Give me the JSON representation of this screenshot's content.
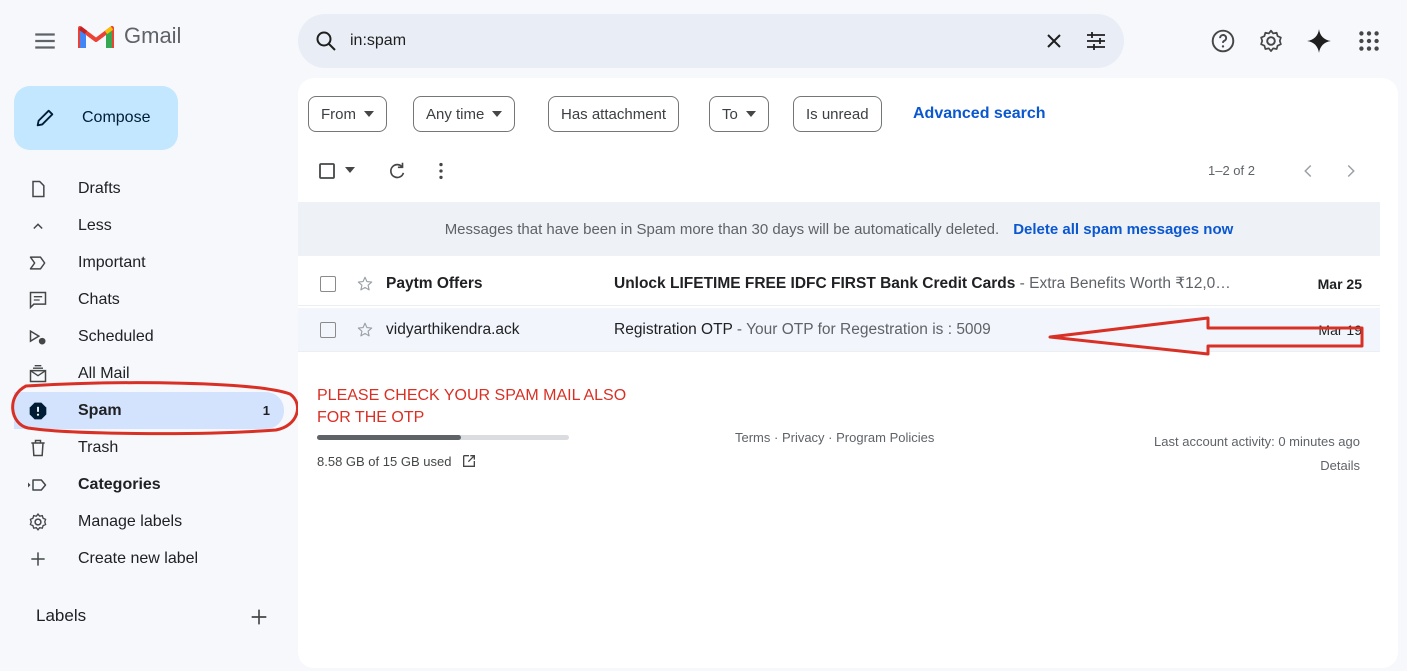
{
  "app": {
    "name": "Gmail"
  },
  "search": {
    "value": "in:spam"
  },
  "sidebar": {
    "compose_label": "Compose",
    "items": [
      {
        "label": "Drafts",
        "icon": "draft-icon"
      },
      {
        "label": "Less",
        "icon": "chevron-up-icon"
      },
      {
        "label": "Important",
        "icon": "important-icon"
      },
      {
        "label": "Chats",
        "icon": "chat-icon"
      },
      {
        "label": "Scheduled",
        "icon": "scheduled-icon"
      },
      {
        "label": "All Mail",
        "icon": "all-mail-icon"
      },
      {
        "label": "Spam",
        "icon": "spam-icon",
        "count": "1",
        "active": true
      },
      {
        "label": "Trash",
        "icon": "trash-icon"
      },
      {
        "label": "Categories",
        "icon": "label-icon"
      },
      {
        "label": "Manage labels",
        "icon": "gear-icon"
      },
      {
        "label": "Create new label",
        "icon": "plus-icon"
      }
    ],
    "labels_heading": "Labels"
  },
  "filters": {
    "from": "From",
    "any_time": "Any time",
    "has_attachment": "Has attachment",
    "to": "To",
    "is_unread": "Is unread",
    "advanced": "Advanced search"
  },
  "toolbar": {
    "pager": "1–2 of 2"
  },
  "banner": {
    "text": "Messages that have been in Spam more than 30 days will be automatically deleted.",
    "link": "Delete all spam messages now"
  },
  "emails": [
    {
      "sender": "Paytm Offers",
      "subject": "Unlock LIFETIME FREE IDFC FIRST Bank Credit Cards",
      "snippet": " - Extra Benefits Worth ₹12,0…",
      "date": "Mar 25",
      "unread": true
    },
    {
      "sender": "vidyarthikendra.ack",
      "subject": "Registration OTP",
      "snippet": " - Your OTP for Regestration is : 5009",
      "date": "Mar 19",
      "unread": false
    }
  ],
  "annotation": {
    "line1": "PLEASE CHECK YOUR SPAM MAIL ALSO",
    "line2": "FOR THE OTP",
    "color": "#d93025"
  },
  "storage": {
    "text": "8.58 GB of 15 GB used",
    "used_fraction": 0.572
  },
  "footer": {
    "links": "Terms · Privacy · Program Policies",
    "activity": "Last account activity: 0 minutes ago",
    "details": "Details"
  },
  "colors": {
    "accent": "#0b57d0",
    "compose_bg": "#c2e7ff",
    "active_nav": "#d3e3fd"
  }
}
